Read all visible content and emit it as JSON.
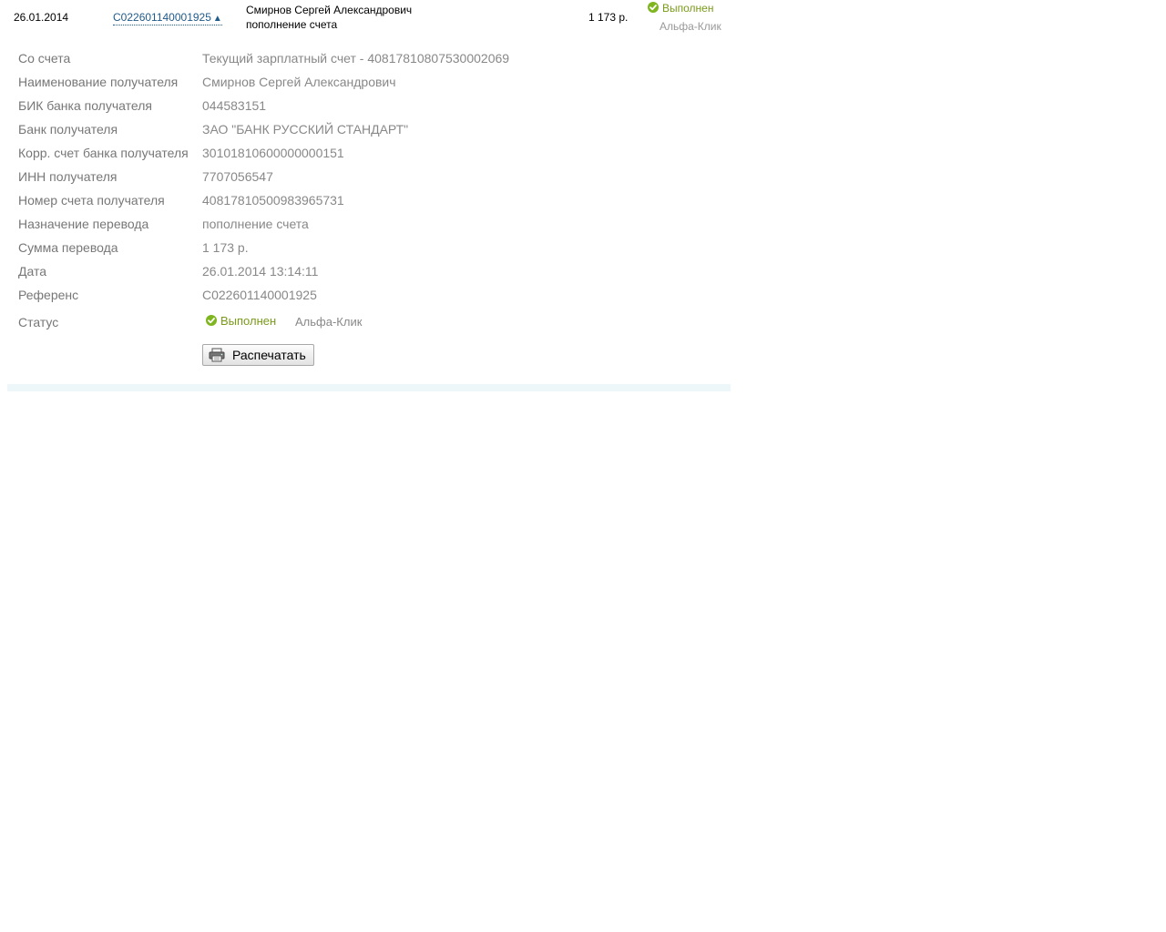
{
  "summary": {
    "date": "26.01.2014",
    "reference": "C022601140001925",
    "arrow": "▲",
    "recipient": "Смирнов Сергей Александрович",
    "purpose": "пополнение счета",
    "amount": "1 173 р.",
    "status": "Выполнен",
    "channel": "Альфа-Клик"
  },
  "details": {
    "rows": [
      {
        "label": "Со счета",
        "value": "Текущий зарплатный счет - 40817810807530002069"
      },
      {
        "label": "Наименование получателя",
        "value": "Смирнов Сергей Александрович"
      },
      {
        "label": "БИК банка получателя",
        "value": "044583151"
      },
      {
        "label": "Банк получателя",
        "value": "ЗАО \"БАНК РУССКИЙ СТАНДАРТ\""
      },
      {
        "label": "Корр. счет банка получателя",
        "value": "30101810600000000151"
      },
      {
        "label": "ИНН получателя",
        "value": "7707056547"
      },
      {
        "label": "Номер счета получателя",
        "value": "40817810500983965731"
      },
      {
        "label": "Назначение перевода",
        "value": "пополнение счета"
      },
      {
        "label": "Сумма перевода",
        "value": "1 173 р."
      },
      {
        "label": "Дата",
        "value": "26.01.2014 13:14:11"
      },
      {
        "label": "Референс",
        "value": "C022601140001925"
      }
    ],
    "status_label": "Статус",
    "status_value": "Выполнен",
    "status_channel": "Альфа-Клик",
    "print_label": "Распечатать"
  },
  "colors": {
    "link": "#1f5a8a",
    "status_green": "#7a9a1a",
    "check_icon": "#7fb51e",
    "muted_text": "#888888",
    "bottom_bar": "#edf6f8"
  },
  "icons": {
    "status": "check-circle-icon",
    "print": "printer-icon",
    "sort": "triangle-up-icon"
  }
}
